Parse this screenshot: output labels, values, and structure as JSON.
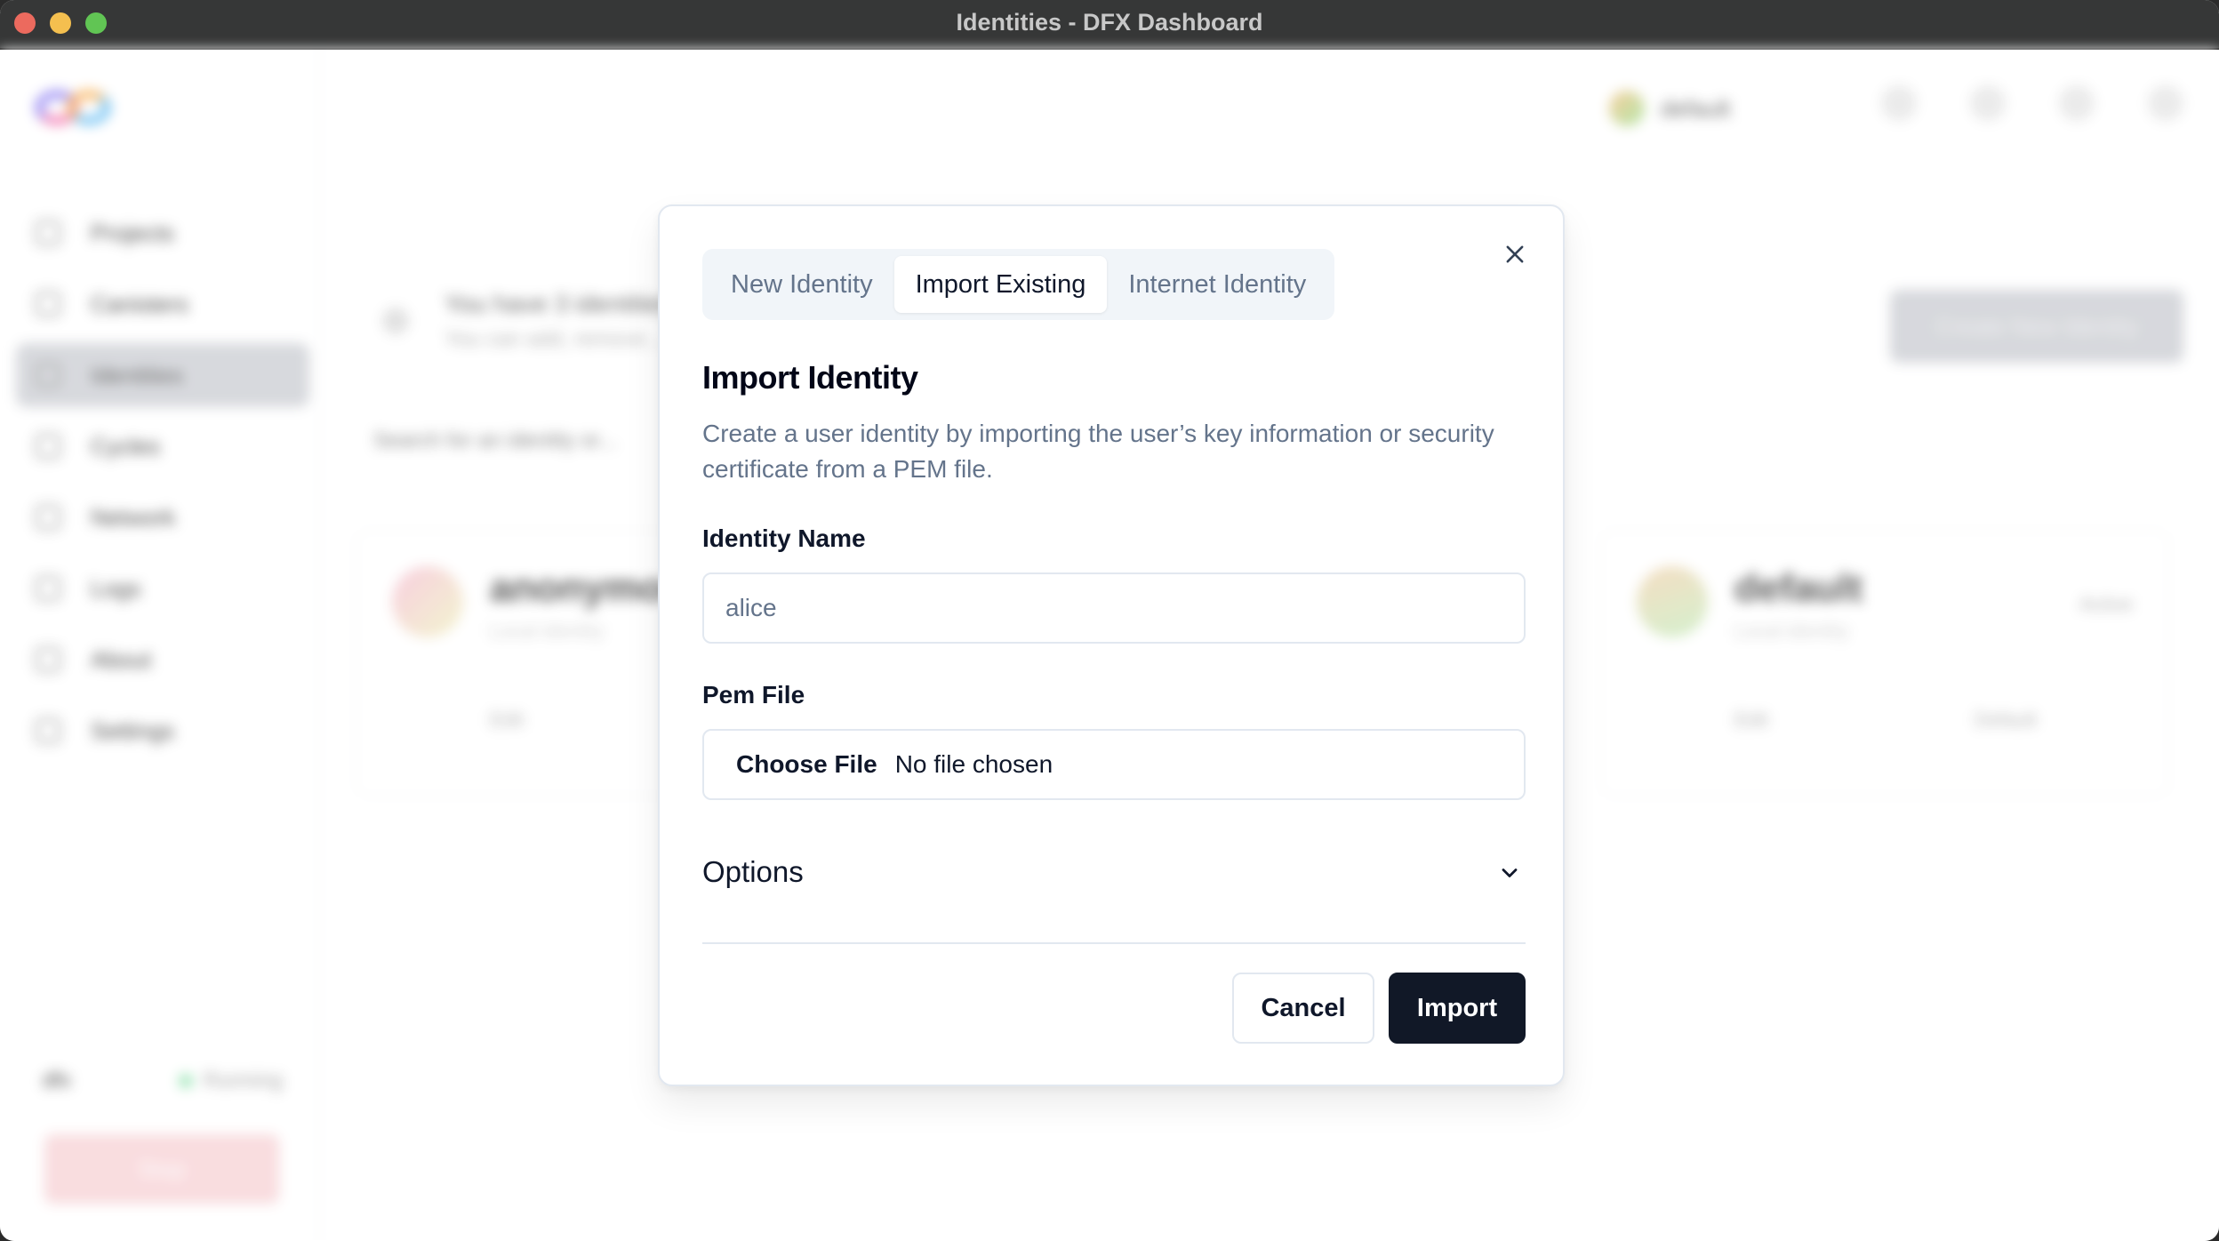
{
  "window": {
    "title": "Identities - DFX Dashboard"
  },
  "sidebar": {
    "items": [
      {
        "label": "Projects",
        "icon": "folder-icon",
        "active": false
      },
      {
        "label": "Canisters",
        "icon": "box-icon",
        "active": false
      },
      {
        "label": "Identities",
        "icon": "user-icon",
        "active": true
      },
      {
        "label": "Cycles",
        "icon": "cycles-icon",
        "active": false
      },
      {
        "label": "Network",
        "icon": "network-icon",
        "active": false
      },
      {
        "label": "Logs",
        "icon": "logs-icon",
        "active": false
      },
      {
        "label": "About",
        "icon": "info-icon",
        "active": false
      },
      {
        "label": "Settings",
        "icon": "gear-icon",
        "active": false
      }
    ],
    "footer": {
      "name": "dfx",
      "status": "Running",
      "status_color": "#22c55e",
      "stop_label": "Stop",
      "stop_color": "#ef4444"
    }
  },
  "topbar": {
    "current_identity": "default"
  },
  "main": {
    "banner_title": "You have 3 identities",
    "banner_subtitle": "You can add, remove...",
    "create_button": "Create New Identity",
    "search_placeholder": "Search for an identity or...",
    "cards": [
      {
        "name": "anonymous",
        "desc": "Local identity",
        "action1": "Edit",
        "action2": ""
      },
      {
        "name": "",
        "desc": "",
        "action1": "",
        "action2": ""
      },
      {
        "name": "default",
        "desc": "Local identity",
        "badge": "Active",
        "action1": "Edit",
        "action2": "Default"
      }
    ]
  },
  "dialog": {
    "tabs": [
      {
        "label": "New Identity",
        "active": false
      },
      {
        "label": "Import Existing",
        "active": true
      },
      {
        "label": "Internet Identity",
        "active": false
      }
    ],
    "title": "Import Identity",
    "description": "Create a user identity by importing the user’s key information or security certificate from a PEM file.",
    "identity_name_label": "Identity Name",
    "identity_name_placeholder": "alice",
    "identity_name_value": "",
    "pem_file_label": "Pem File",
    "choose_file_label": "Choose File",
    "file_status": "No file chosen",
    "options_label": "Options",
    "cancel_label": "Cancel",
    "import_label": "Import",
    "colors": {
      "primary": "#111827",
      "muted_text": "#64748b",
      "tab_bg": "#f1f5f9",
      "border": "#e2e8f0"
    }
  }
}
